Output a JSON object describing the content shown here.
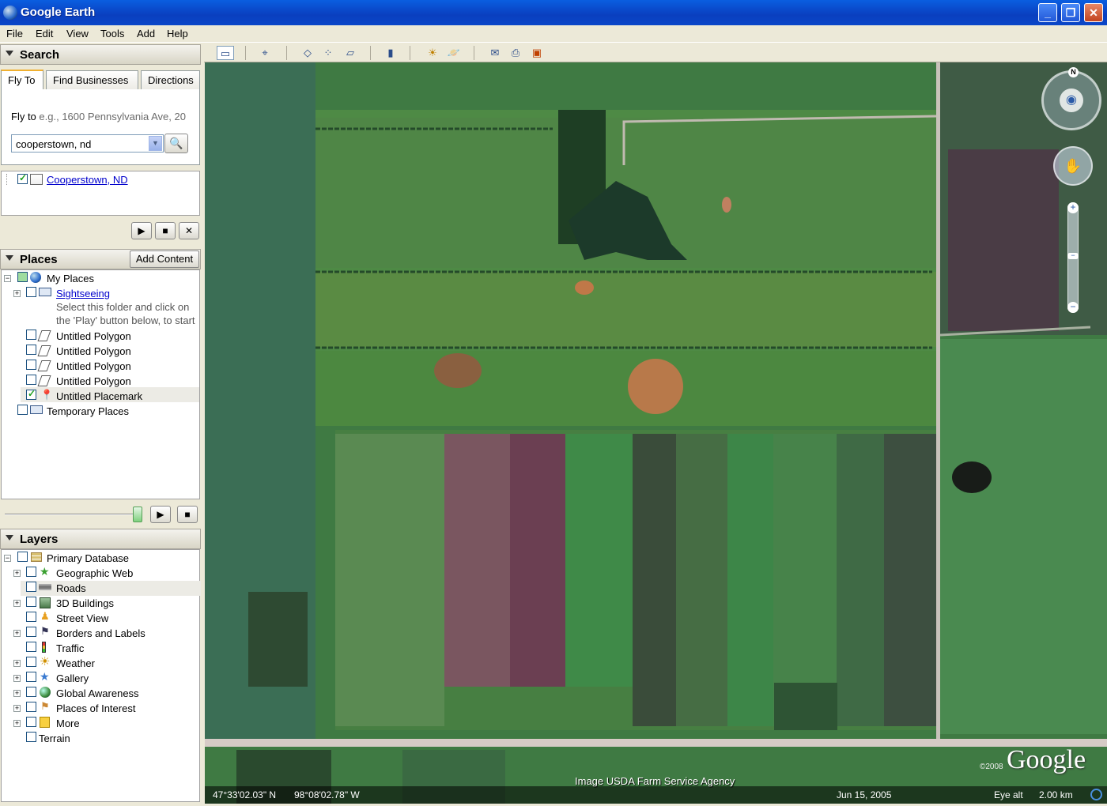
{
  "window": {
    "title": "Google Earth"
  },
  "menu": [
    "File",
    "Edit",
    "View",
    "Tools",
    "Add",
    "Help"
  ],
  "search": {
    "header": "Search",
    "tabs": [
      "Fly To",
      "Find Businesses",
      "Directions"
    ],
    "fly_to_label": "Fly to",
    "fly_to_hint": "e.g., 1600 Pennsylvania Ave, 20",
    "query": "cooperstown, nd",
    "result": "Cooperstown, ND"
  },
  "places": {
    "header": "Places",
    "add_content": "Add Content",
    "items": [
      {
        "label": "My Places"
      },
      {
        "label": "Sightseeing",
        "note1": "Select this folder and click on",
        "note2": "the 'Play' button below, to start"
      },
      {
        "label": "Untitled Polygon"
      },
      {
        "label": "Untitled Polygon"
      },
      {
        "label": "Untitled Polygon"
      },
      {
        "label": "Untitled Polygon"
      },
      {
        "label": "Untitled Placemark"
      },
      {
        "label": "Temporary Places"
      }
    ]
  },
  "layers": {
    "header": "Layers",
    "items": [
      {
        "label": "Primary Database"
      },
      {
        "label": "Geographic Web"
      },
      {
        "label": "Roads"
      },
      {
        "label": "3D Buildings"
      },
      {
        "label": "Street View"
      },
      {
        "label": "Borders and Labels"
      },
      {
        "label": "Traffic"
      },
      {
        "label": "Weather"
      },
      {
        "label": "Gallery"
      },
      {
        "label": "Global Awareness"
      },
      {
        "label": "Places of Interest"
      },
      {
        "label": "More"
      },
      {
        "label": "Terrain"
      }
    ]
  },
  "map": {
    "credit": "Image USDA Farm Service Agency",
    "copyright_year": "©2008",
    "logo": "Google",
    "latitude": "47°33'02.03\" N",
    "longitude": "98°08'02.78\" W",
    "date": "Jun 15, 2005",
    "eye_alt_label": "Eye alt",
    "eye_alt_value": "2.00 km",
    "north": "N"
  },
  "colors": {
    "titlebar": "#0a5ee0",
    "panel": "#ece9d8",
    "link": "#0000cc"
  }
}
